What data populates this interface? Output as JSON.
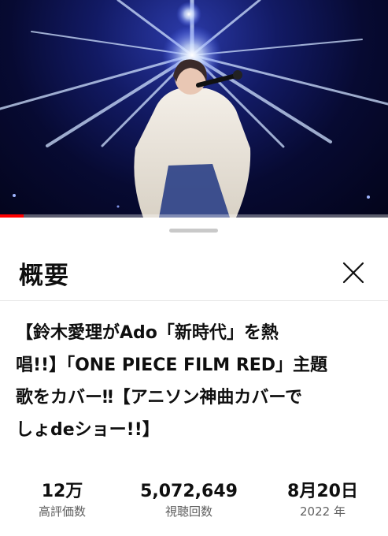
{
  "video": {
    "progress_fraction": 0.06,
    "progress_color": "#ff0000"
  },
  "description_sheet": {
    "title": "概要",
    "close_icon": "close-x-icon",
    "video_title_lines": [
      "【鈴木愛理がAdo「新時代」を熱",
      "唱!!】「ONE PIECE FILM RED」主題",
      "歌をカバー‼【アニソン神曲カバーで",
      "しょdeショー!!】"
    ],
    "stats": {
      "likes_value": "12万",
      "likes_label": "高評価数",
      "views_value": "5,072,649",
      "views_label": "視聴回数",
      "date_value": "8月20日",
      "date_label": "2022 年"
    }
  }
}
